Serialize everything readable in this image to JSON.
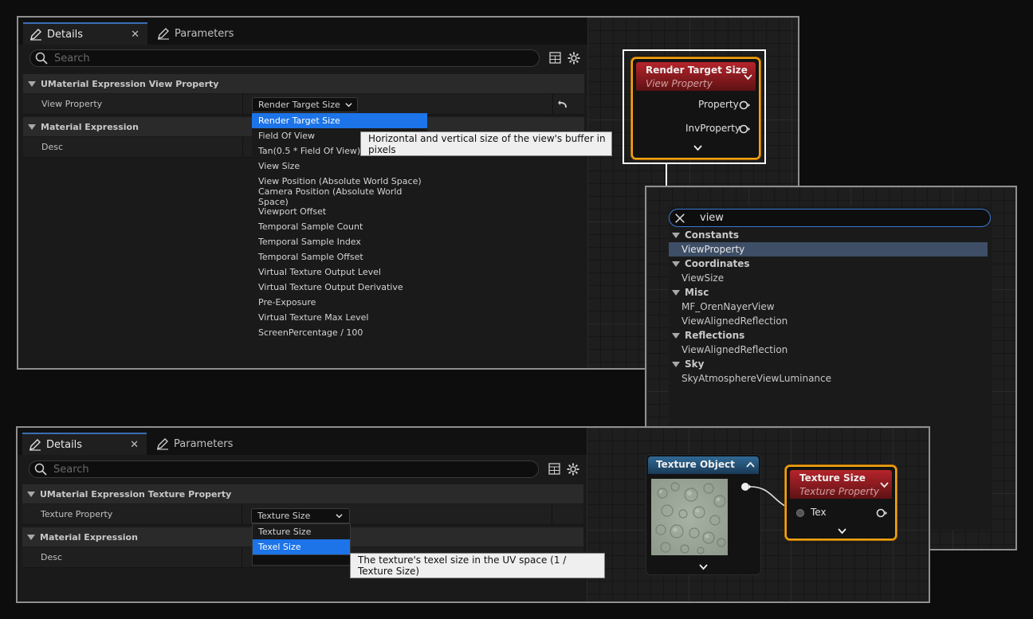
{
  "top_panel": {
    "tabs": [
      {
        "label": "Details"
      },
      {
        "label": "Parameters"
      }
    ],
    "search_placeholder": "Search",
    "category1": "UMaterial Expression View Property",
    "property_label": "View Property",
    "property_value": "Render Target Size",
    "category2": "Material Expression",
    "desc_label": "Desc",
    "dropdown_items": [
      "Render Target Size",
      "Field Of View",
      "Tan(0.5 * Field Of View)",
      "View Size",
      "View Position (Absolute World Space)",
      "Camera Position (Absolute World Space)",
      "Viewport Offset",
      "Temporal Sample Count",
      "Temporal Sample Index",
      "Temporal Sample Offset",
      "Virtual Texture Output Level",
      "Virtual Texture Output Derivative",
      "Pre-Exposure",
      "Virtual Texture Max Level",
      "ScreenPercentage / 100"
    ],
    "tooltip": "Horizontal and vertical size of the view's buffer in pixels"
  },
  "view_node": {
    "title": "Render Target Size",
    "subtitle": "View Property",
    "pins": [
      "Property",
      "InvProperty"
    ]
  },
  "palette": {
    "search_value": "view",
    "groups": [
      {
        "name": "Constants",
        "items": [
          "ViewProperty"
        ]
      },
      {
        "name": "Coordinates",
        "items": [
          "ViewSize"
        ]
      },
      {
        "name": "Misc",
        "items": [
          "MF_OrenNayerView",
          "ViewAlignedReflection"
        ]
      },
      {
        "name": "Reflections",
        "items": [
          "ViewAlignedReflection"
        ]
      },
      {
        "name": "Sky",
        "items": [
          "SkyAtmosphereViewLuminance"
        ]
      }
    ],
    "highlighted": "ViewProperty"
  },
  "bottom_panel": {
    "tabs": [
      {
        "label": "Details"
      },
      {
        "label": "Parameters"
      }
    ],
    "search_placeholder": "Search",
    "category1": "UMaterial Expression Texture Property",
    "property_label": "Texture Property",
    "property_value": "Texture Size",
    "category2": "Material Expression",
    "desc_label": "Desc",
    "dropdown_items": [
      "Texture Size",
      "Texel Size"
    ],
    "tooltip": "The texture's texel size in the UV space (1 / Texture Size)"
  },
  "texture_object_node": {
    "title": "Texture Object"
  },
  "texture_size_node": {
    "title": "Texture Size",
    "subtitle": "Texture Property",
    "pins": [
      "Tex"
    ]
  },
  "colors": {
    "accent_blue": "#1c74e8",
    "node_selected": "#f2a413",
    "node_header_red": "#b5242b",
    "node_header_blue": "#2a5a84"
  },
  "icons": [
    "pen-icon",
    "close-icon",
    "search-icon",
    "table-icon",
    "gear-icon",
    "reset-icon",
    "chevron-down-icon",
    "chevron-up-icon"
  ]
}
